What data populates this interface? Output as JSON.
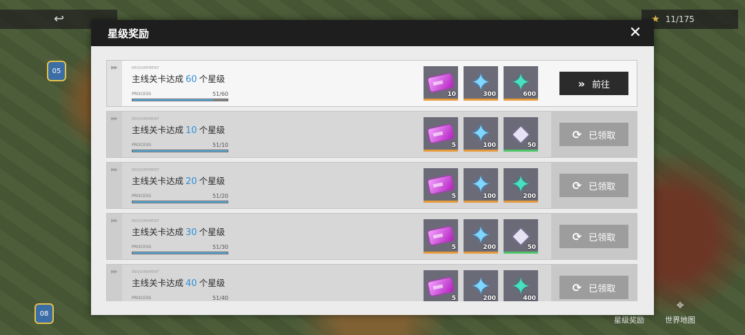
{
  "hud": {
    "star_count": "11/175",
    "nav_star_reward": "星级奖励",
    "nav_world_map": "世界地图"
  },
  "dialog": {
    "title": "星级奖励",
    "requirement_label": "REQUIREMENT",
    "process_label": "PROCESS",
    "rows": [
      {
        "prefix": "主线关卡达成",
        "target": "60",
        "suffix": "个星级",
        "process": "51/60",
        "progress": 0.85,
        "rewards": [
          {
            "icon": "ticket-icon",
            "qty": "10"
          },
          {
            "icon": "blue-crystal-icon",
            "qty": "300"
          },
          {
            "icon": "teal-crystal-icon",
            "qty": "600"
          }
        ],
        "action": "前往",
        "action_icon": "»",
        "state": "go"
      },
      {
        "prefix": "主线关卡达成",
        "target": "10",
        "suffix": "个星级",
        "process": "51/10",
        "progress": 1,
        "rewards": [
          {
            "icon": "ticket-icon",
            "qty": "5"
          },
          {
            "icon": "blue-crystal-icon",
            "qty": "100"
          },
          {
            "icon": "prism-crystal-icon",
            "qty": "50"
          }
        ],
        "action": "已领取",
        "action_icon": "⟳",
        "state": "claimed"
      },
      {
        "prefix": "主线关卡达成",
        "target": "20",
        "suffix": "个星级",
        "process": "51/20",
        "progress": 1,
        "rewards": [
          {
            "icon": "ticket-icon",
            "qty": "5"
          },
          {
            "icon": "blue-crystal-icon",
            "qty": "100"
          },
          {
            "icon": "teal-crystal-icon",
            "qty": "200"
          }
        ],
        "action": "已领取",
        "action_icon": "⟳",
        "state": "claimed"
      },
      {
        "prefix": "主线关卡达成",
        "target": "30",
        "suffix": "个星级",
        "process": "51/30",
        "progress": 1,
        "rewards": [
          {
            "icon": "ticket-icon",
            "qty": "5"
          },
          {
            "icon": "blue-crystal-icon",
            "qty": "200"
          },
          {
            "icon": "prism-crystal-icon",
            "qty": "50"
          }
        ],
        "action": "已领取",
        "action_icon": "⟳",
        "state": "claimed"
      },
      {
        "prefix": "主线关卡达成",
        "target": "40",
        "suffix": "个星级",
        "process": "51/40",
        "progress": 1,
        "rewards": [
          {
            "icon": "ticket-icon",
            "qty": "5"
          },
          {
            "icon": "blue-crystal-icon",
            "qty": "200"
          },
          {
            "icon": "teal-crystal-icon",
            "qty": "400"
          }
        ],
        "action": "已领取",
        "action_icon": "⟳",
        "state": "claimed"
      }
    ]
  },
  "colors": {
    "accent_blue": "#2f8fd8",
    "header_dark": "#1e1e1e",
    "progress_fill": "#5aaee0"
  }
}
